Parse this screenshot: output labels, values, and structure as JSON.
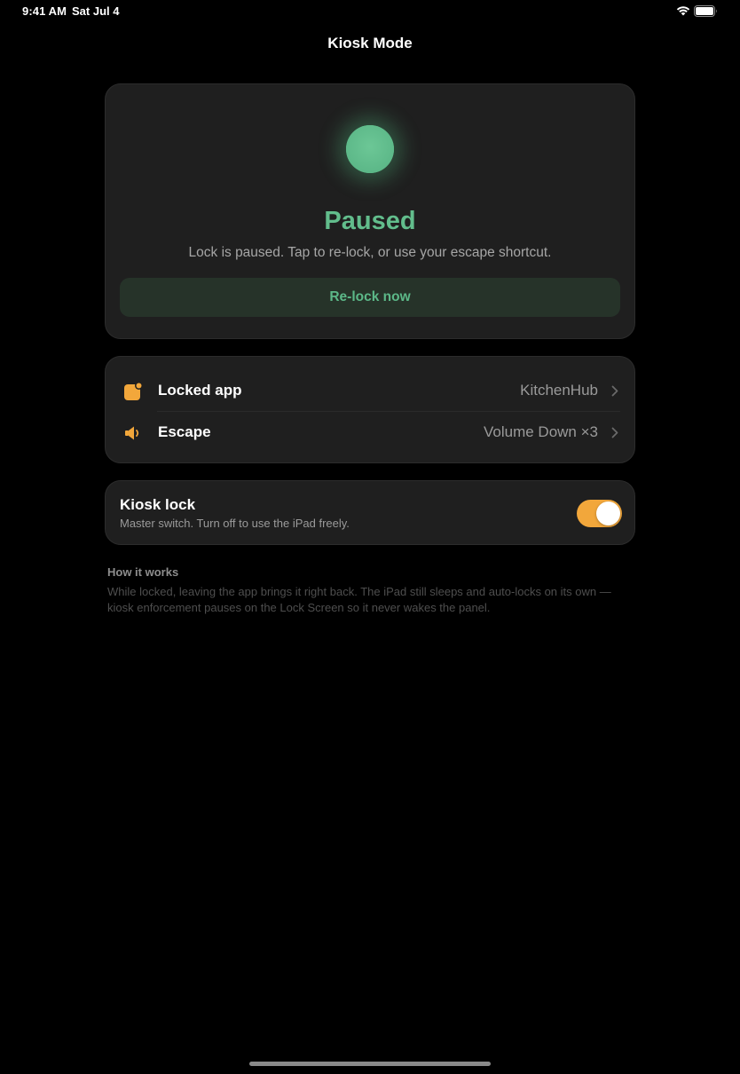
{
  "status_bar": {
    "time": "9:41 AM",
    "date": "Sat Jul 4",
    "wifi_icon": "wifi-icon",
    "battery_icon": "battery-icon"
  },
  "nav": {
    "title": "Kiosk Mode"
  },
  "status_card": {
    "indicator_color": "#5fbf8c",
    "title": "Paused",
    "description": "Lock is paused. Tap to re-lock, or use your escape shortcut.",
    "relock_button": "Re-lock now"
  },
  "settings_rows": [
    {
      "icon": "app-badge-icon",
      "label": "Locked app",
      "value": "KitchenHub"
    },
    {
      "icon": "speaker-icon",
      "label": "Escape",
      "value": "Volume Down ×3"
    }
  ],
  "kiosk_lock": {
    "title": "Kiosk lock",
    "subtitle": "Master switch. Turn off to use the iPad freely.",
    "enabled": true,
    "toggle_color": "#f2a73b"
  },
  "how_it_works": {
    "title": "How it works",
    "body": "While locked, leaving the app brings it right back. The iPad still sleeps and auto-locks on its own — kiosk enforcement pauses on the Lock Screen so it never wakes the panel."
  },
  "colors": {
    "accent_green": "#62bd8c",
    "accent_orange": "#f2a73b",
    "background": "#000000",
    "card": "#1f1f1f"
  }
}
